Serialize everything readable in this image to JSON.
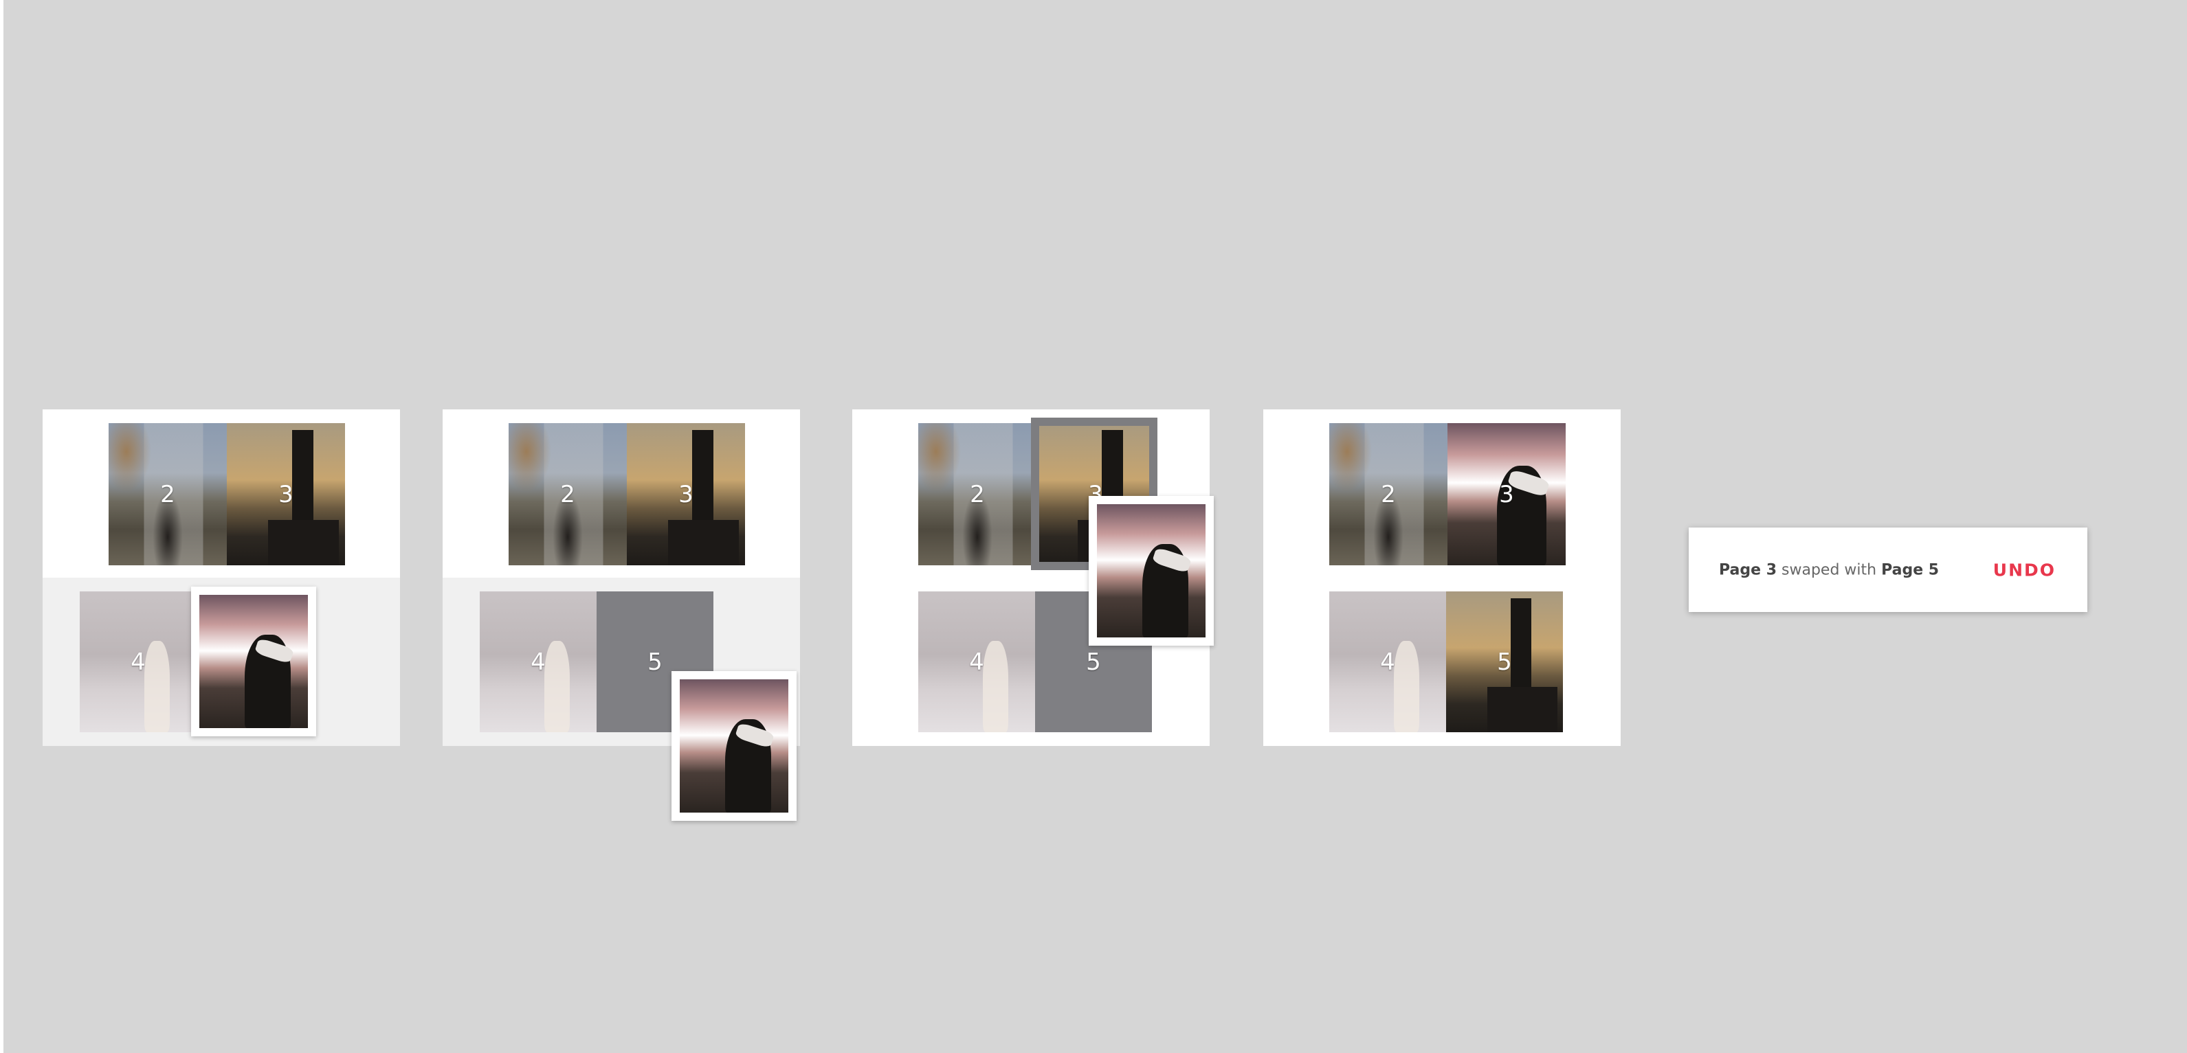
{
  "frames": [
    {
      "step": 1,
      "pages": {
        "p2": "2",
        "p3": "3",
        "p4": "4"
      }
    },
    {
      "step": 2,
      "pages": {
        "p2": "2",
        "p3": "3",
        "p4": "4",
        "p5": "5"
      }
    },
    {
      "step": 3,
      "pages": {
        "p2": "2",
        "p3": "3",
        "p4": "4",
        "p5": "5"
      }
    },
    {
      "step": 4,
      "pages": {
        "p2": "2",
        "p3": "3",
        "p4": "4",
        "p5": "5"
      }
    }
  ],
  "toast": {
    "page_a": "Page 3",
    "middle": " swaped with ",
    "page_b": "Page 5",
    "undo_label": "UNDO"
  },
  "colors": {
    "background": "#d6d6d6",
    "card": "#ffffff",
    "drop_target": "#7d7d80",
    "undo_accent": "#e8374c"
  }
}
